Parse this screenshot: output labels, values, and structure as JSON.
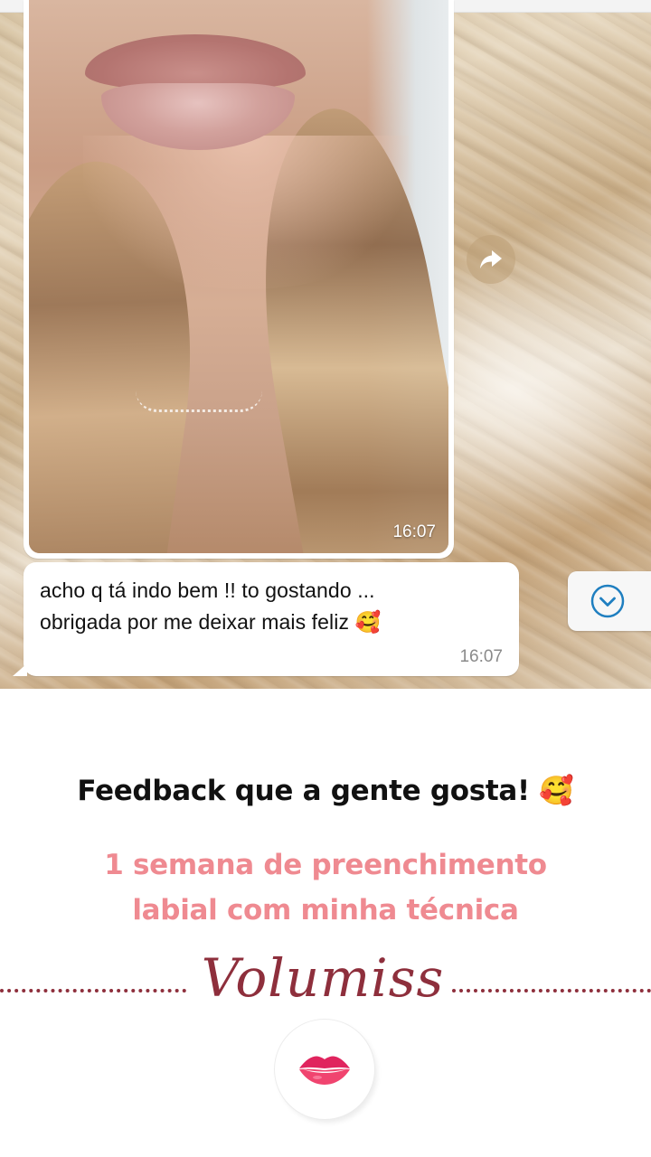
{
  "chat": {
    "photo_time": "16:07",
    "message_lines": [
      "acho q  tá indo bem !!  to gostando ...",
      "obrigada por me deixar mais feliz 🥰"
    ],
    "message_time": "16:07"
  },
  "story": {
    "headline": "Feedback que a gente gosta! 🥰",
    "subhead_lines": [
      "1 semana de preenchimento",
      "labial com minha técnica"
    ],
    "brand": "Volumiss"
  },
  "icons": {
    "forward": "forward-arrow-icon",
    "scroll_down": "chevron-down-icon",
    "lips": "lips-icon"
  },
  "colors": {
    "subhead": "#ef8a91",
    "brand": "#8e2f3c",
    "scroll_icon": "#1f7fc0"
  }
}
